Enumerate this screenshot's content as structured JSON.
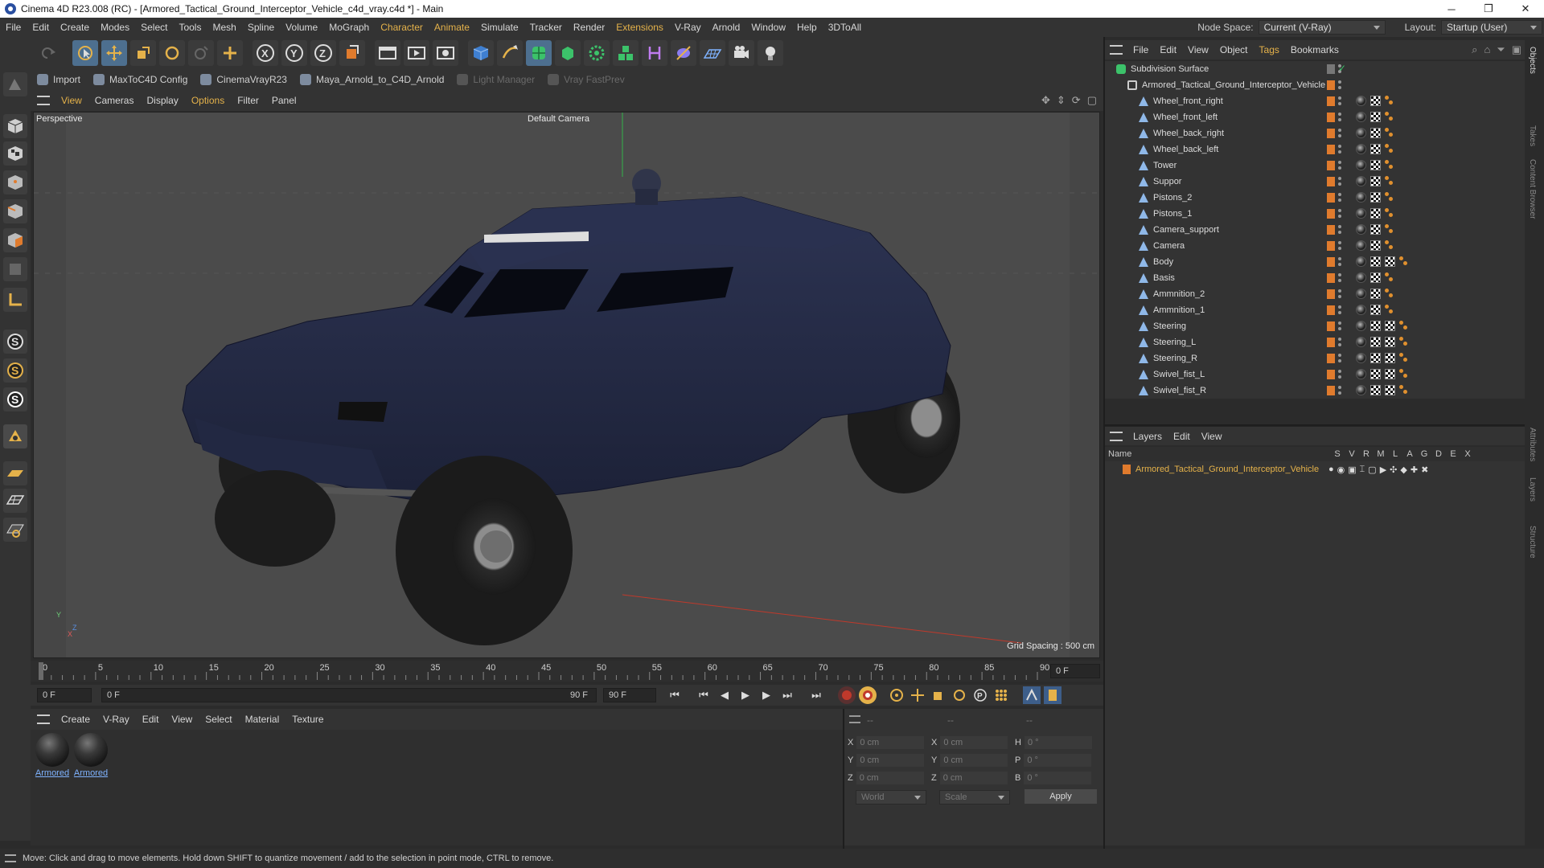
{
  "window": {
    "title": "Cinema 4D R23.008 (RC) - [Armored_Tactical_Ground_Interceptor_Vehicle_c4d_vray.c4d *] - Main",
    "minimize": "─",
    "restore": "❐",
    "close": "✕"
  },
  "menu": {
    "items": [
      "File",
      "Edit",
      "Create",
      "Modes",
      "Select",
      "Tools",
      "Mesh",
      "Spline",
      "Volume",
      "MoGraph",
      "Character",
      "Animate",
      "Simulate",
      "Tracker",
      "Render",
      "Extensions",
      "V-Ray",
      "Arnold",
      "Window",
      "Help",
      "3DToAll"
    ],
    "node_space_label": "Node Space:",
    "node_space_value": "Current (V-Ray)",
    "layout_label": "Layout:",
    "layout_value": "Startup (User)"
  },
  "plugins": [
    {
      "label": "Import",
      "dim": false
    },
    {
      "label": "MaxToC4D Config",
      "dim": false
    },
    {
      "label": "CinemaVrayR23",
      "dim": false
    },
    {
      "label": "Maya_Arnold_to_C4D_Arnold",
      "dim": false
    },
    {
      "label": "Light Manager",
      "dim": true
    },
    {
      "label": "Vray FastPrev",
      "dim": true
    }
  ],
  "viewport_menu": [
    "View",
    "Cameras",
    "Display",
    "Options",
    "Filter",
    "Panel"
  ],
  "viewport": {
    "name": "Perspective",
    "camera": "Default Camera",
    "grid_spacing": "Grid Spacing : 500 cm",
    "axis_y": "Y",
    "axis_z": "Z",
    "axis_x": "X"
  },
  "timeline": {
    "ticks": [
      "0",
      "5",
      "10",
      "15",
      "20",
      "25",
      "30",
      "35",
      "40",
      "45",
      "50",
      "55",
      "60",
      "65",
      "70",
      "75",
      "80",
      "85",
      "90"
    ],
    "current_frame": "0 F"
  },
  "transport": {
    "start": "0 F",
    "current": "0 F",
    "end_slider": "90 F",
    "end": "90 F"
  },
  "material_menu": [
    "Create",
    "V-Ray",
    "Edit",
    "View",
    "Select",
    "Material",
    "Texture"
  ],
  "materials": [
    {
      "name": "Armored"
    },
    {
      "name": "Armored"
    }
  ],
  "coords": {
    "header": [
      "--",
      "--",
      "--"
    ],
    "x": "0 cm",
    "y": "0 cm",
    "z": "0 cm",
    "x2": "0 cm",
    "y2": "0 cm",
    "z2": "0 cm",
    "h": "0 °",
    "p": "0 °",
    "b": "0 °",
    "l_x": "X",
    "l_y": "Y",
    "l_z": "Z",
    "l_x2": "X",
    "l_y2": "Y",
    "l_z2": "Z",
    "l_h": "H",
    "l_p": "P",
    "l_b": "B",
    "world": "World",
    "scale": "Scale",
    "apply": "Apply"
  },
  "objects_menu": [
    "File",
    "Edit",
    "View",
    "Object",
    "Tags",
    "Bookmarks"
  ],
  "objects": {
    "root": "Subdivision Surface",
    "parent": "Armored_Tactical_Ground_Interceptor_Vehicle",
    "children": [
      {
        "name": "Wheel_front_right",
        "tags": 3
      },
      {
        "name": "Wheel_front_left",
        "tags": 3
      },
      {
        "name": "Wheel_back_right",
        "tags": 3
      },
      {
        "name": "Wheel_back_left",
        "tags": 3
      },
      {
        "name": "Tower",
        "tags": 3
      },
      {
        "name": "Suppor",
        "tags": 3
      },
      {
        "name": "Pistons_2",
        "tags": 3
      },
      {
        "name": "Pistons_1",
        "tags": 3
      },
      {
        "name": "Camera_support",
        "tags": 3
      },
      {
        "name": "Camera",
        "tags": 3
      },
      {
        "name": "Body",
        "tags": 4
      },
      {
        "name": "Basis",
        "tags": 3
      },
      {
        "name": "Ammnition_2",
        "tags": 3
      },
      {
        "name": "Ammnition_1",
        "tags": 3
      },
      {
        "name": "Steering",
        "tags": 4
      },
      {
        "name": "Steering_L",
        "tags": 4
      },
      {
        "name": "Steering_R",
        "tags": 4
      },
      {
        "name": "Swivel_fist_L",
        "tags": 4
      },
      {
        "name": "Swivel_fist_R",
        "tags": 4
      }
    ]
  },
  "layers_menu": [
    "Layers",
    "Edit",
    "View"
  ],
  "layers": {
    "columns": [
      "Name",
      "S",
      "V",
      "R",
      "M",
      "L",
      "A",
      "G",
      "D",
      "E",
      "X"
    ],
    "rows": [
      {
        "name": "Armored_Tactical_Ground_Interceptor_Vehicle"
      }
    ]
  },
  "right_tabs": [
    "Objects",
    "Takes",
    "Content Browser",
    "Attributes",
    "Layers",
    "Structure"
  ],
  "status": "Move: Click and drag to move elements. Hold down SHIFT to quantize movement / add to the selection in point mode, CTRL to remove.",
  "colors": {
    "accent": "#e5b24a",
    "orange": "#e07b2d",
    "link": "#7fb3ff"
  }
}
